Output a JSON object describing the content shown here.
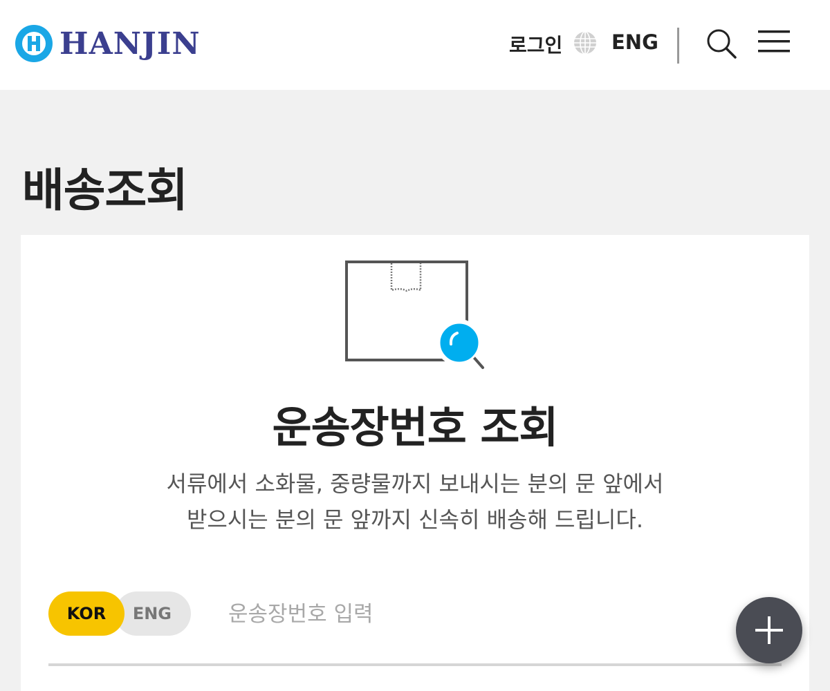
{
  "header": {
    "logo_text": "HANJIN",
    "login_label": "로그인",
    "language_label": "ENG",
    "icons": [
      "hanjin-logo-icon",
      "globe-icon",
      "search-icon",
      "hamburger-menu-icon"
    ]
  },
  "page": {
    "title": "배송조회"
  },
  "tracking_card": {
    "illustration_icon": "box-search-icon",
    "title": "운송장번호 조회",
    "description_line1": "서류에서 소화물, 중량물까지 보내시는 분의 문 앞에서",
    "description_line2": "받으시는 분의 문 앞까지 신속히 배송해 드립니다.",
    "lang_toggle": {
      "options": [
        "KOR",
        "ENG"
      ],
      "selected": "KOR"
    },
    "waybill_input": {
      "placeholder": "운송장번호 입력",
      "value": ""
    }
  },
  "fab": {
    "icon": "plus-icon"
  },
  "colors": {
    "brand_blue": "#3b3f8f",
    "logo_cyan": "#1aa7e6",
    "accent_yellow": "#f7c400",
    "magnifier_blue": "#00aeef",
    "fab_dark": "#4a4c54"
  }
}
